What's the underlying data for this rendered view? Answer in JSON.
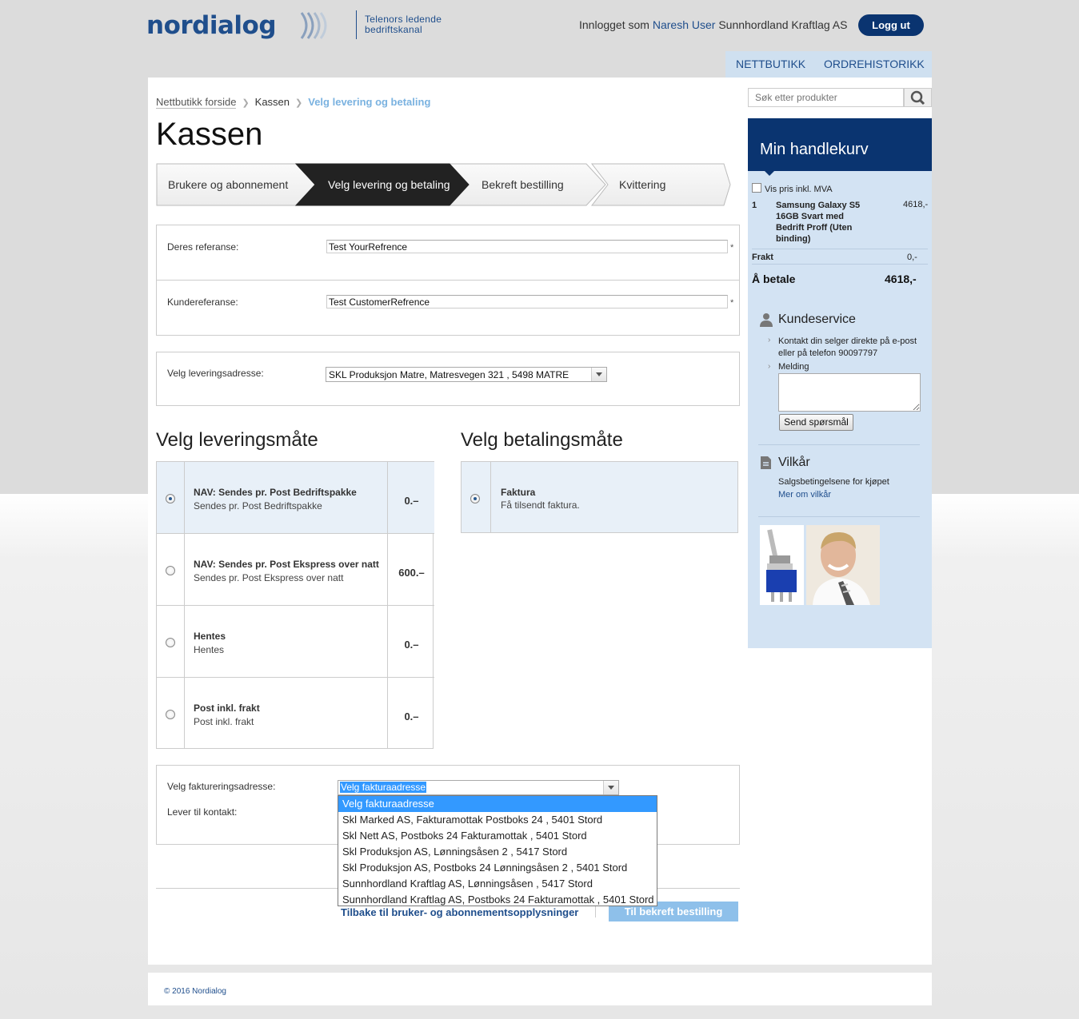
{
  "header": {
    "logo_text": "nordialog",
    "tagline_line1": "Telenors ledende",
    "tagline_line2": "bedriftskanal",
    "login_prefix": "Innlogget som",
    "user_name": "Naresh User",
    "company": "Sunnhordland Kraftlag AS",
    "logout_label": "Logg ut"
  },
  "nav": {
    "shop": "NETTBUTIKK",
    "orders": "ORDREHISTORIKK"
  },
  "breadcrumb": {
    "home": "Nettbutikk forside",
    "checkout": "Kassen",
    "current": "Velg levering og betaling"
  },
  "page_title": "Kassen",
  "steps": [
    {
      "label": "Brukere og abonnement"
    },
    {
      "label": "Velg levering og betaling"
    },
    {
      "label": "Bekreft bestilling"
    },
    {
      "label": "Kvittering"
    }
  ],
  "references": {
    "your_ref_label": "Deres referanse:",
    "your_ref_value": "Test YourRefrence",
    "customer_ref_label": "Kundereferanse:",
    "customer_ref_value": "Test CustomerRefrence",
    "required_mark": "*"
  },
  "delivery_address": {
    "label": "Velg leveringsadresse:",
    "selected": "SKL Produksjon Matre, Matresvegen 321 , 5498 MATRE"
  },
  "delivery": {
    "heading": "Velg leveringsmåte",
    "options": [
      {
        "title": "NAV: Sendes pr. Post Bedriftspakke",
        "subtitle": "Sendes pr. Post Bedriftspakke",
        "price": "0.–",
        "selected": true
      },
      {
        "title": "NAV: Sendes pr. Post Ekspress over natt",
        "subtitle": "Sendes pr. Post Ekspress over natt",
        "price": "600.–",
        "selected": false
      },
      {
        "title": "Hentes",
        "subtitle": "Hentes",
        "price": "0.–",
        "selected": false
      },
      {
        "title": "Post inkl. frakt",
        "subtitle": "Post inkl. frakt",
        "price": "0.–",
        "selected": false
      }
    ]
  },
  "payment": {
    "heading": "Velg betalingsmåte",
    "options": [
      {
        "title": "Faktura",
        "subtitle": "Få tilsendt faktura.",
        "selected": true
      }
    ]
  },
  "invoice": {
    "label": "Velg faktureringsadresse:",
    "selected": "Velg fakturaadresse",
    "contact_label": "Lever til kontakt:",
    "options": [
      "Velg fakturaadresse",
      "Skl Marked AS, Fakturamottak Postboks 24 , 5401 Stord",
      "Skl Nett AS, Postboks 24 Fakturamottak , 5401 Stord",
      "Skl Produksjon AS, Lønningsåsen 2 , 5417 Stord",
      "Skl Produksjon AS, Postboks 24 Lønningsåsen 2 , 5401 Stord",
      "Sunnhordland Kraftlag AS, Lønningsåsen , 5417 Stord",
      "Sunnhordland Kraftlag AS, Postboks 24 Fakturamottak , 5401 Stord"
    ]
  },
  "actions": {
    "back": "Tilbake til bruker- og abonnementsopplysninger",
    "confirm": "Til bekreft bestilling"
  },
  "sidebar": {
    "search_placeholder": "Søk etter produkter",
    "cart_title": "Min handlekurv",
    "vat_label": "Vis pris inkl. MVA",
    "item_qty": "1",
    "item_name_l1": "Samsung Galaxy S5",
    "item_name_l2": "16GB Svart med",
    "item_name_l3": "Bedrift Proff (Uten",
    "item_name_l4": "binding)",
    "item_price": "4618,-",
    "freight_label": "Frakt",
    "freight_value": "0,-",
    "total_label": "Å betale",
    "total_value": "4618,-",
    "service_title": "Kundeservice",
    "service_text_l1": "Kontakt din selger direkte på e-post",
    "service_text_l2": "eller på telefon 90097797",
    "message_label": "Melding",
    "send_label": "Send spørsmål",
    "terms_title": "Vilkår",
    "terms_text": "Salgsbetingelsene for kjøpet",
    "terms_link": "Mer om vilkår"
  },
  "footer": {
    "copyright": "© 2016 Nordialog"
  },
  "colors": {
    "brand_dark": "#0a3470",
    "brand": "#1f4e8c",
    "sidebar_bg": "#d3e3f3",
    "accent_light": "#7ab2e0"
  }
}
